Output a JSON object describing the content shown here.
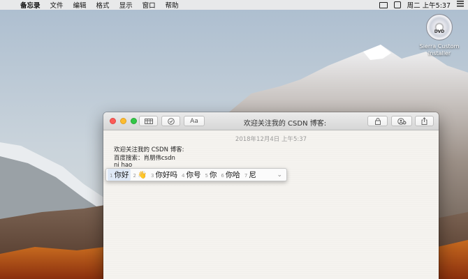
{
  "menubar": {
    "apple": "",
    "items": [
      "备忘录",
      "文件",
      "编辑",
      "格式",
      "显示",
      "窗口",
      "帮助"
    ],
    "clock": "周二 上午5:37"
  },
  "desktop": {
    "dvd_icon_text": "DVD",
    "dvd_label": "Sierra Custom Installer"
  },
  "window": {
    "title": "欢迎关注我的 CSDN 博客:",
    "toolbar": {
      "format_button": "Aa"
    },
    "date": "2018年12月4日 上午5:37",
    "lines": [
      "欢迎关注我的 CSDN 博客:",
      "百度搜索：肖朋伟csdn",
      "ni hao"
    ]
  },
  "ime": {
    "candidates": [
      {
        "num": "1",
        "word": "你好"
      },
      {
        "num": "2",
        "word": "👋"
      },
      {
        "num": "3",
        "word": "你好吗"
      },
      {
        "num": "4",
        "word": "你号"
      },
      {
        "num": "5",
        "word": "你"
      },
      {
        "num": "6",
        "word": "你哈"
      },
      {
        "num": "7",
        "word": "尼"
      }
    ],
    "more_icon": "chevron-down-icon"
  }
}
